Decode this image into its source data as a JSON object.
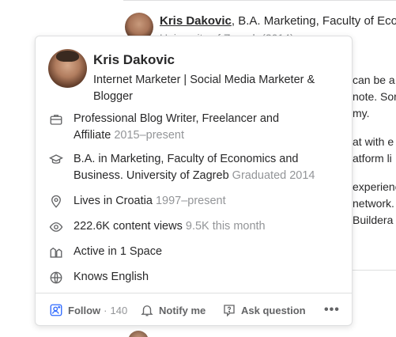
{
  "background": {
    "author": {
      "name": "Kris Dakovic",
      "credential": ", B.A. Marketing, Faculty of Econo",
      "credential_line2": "University of Zagreb (2014)"
    },
    "text_fragments": [
      "can be a",
      "note. Sor",
      "my.",
      "at with e",
      "atform li",
      "experienc",
      "network.",
      "Buildera"
    ]
  },
  "profile_card": {
    "name": "Kris Dakovic",
    "bio": "Internet Marketer | Social Media Marketer & Blogger",
    "credentials": [
      {
        "icon": "briefcase-icon",
        "main": "Professional Blog Writer, Freelancer and Affiliate",
        "meta": "2015–present"
      },
      {
        "icon": "graduation-cap-icon",
        "main": "B.A. in Marketing, Faculty of Economics and Business. University of Zagreb",
        "meta": "Graduated 2014"
      },
      {
        "icon": "location-pin-icon",
        "main": "Lives in Croatia",
        "meta": "1997–present"
      },
      {
        "icon": "eye-icon",
        "main": "222.6K content views",
        "meta": "9.5K this month"
      },
      {
        "icon": "spaces-icon",
        "main": "Active in 1 Space",
        "meta": ""
      },
      {
        "icon": "globe-icon",
        "main": "Knows English",
        "meta": ""
      }
    ],
    "footer": {
      "follow_label": "Follow",
      "follow_separator": "·",
      "follow_count": "140",
      "notify_label": "Notify me",
      "ask_label": "Ask question",
      "more_label": "•••"
    }
  },
  "colors": {
    "text_primary": "#282829",
    "text_muted": "#939598",
    "follow_icon": "#2e69ff",
    "border": "#dedfe0"
  }
}
